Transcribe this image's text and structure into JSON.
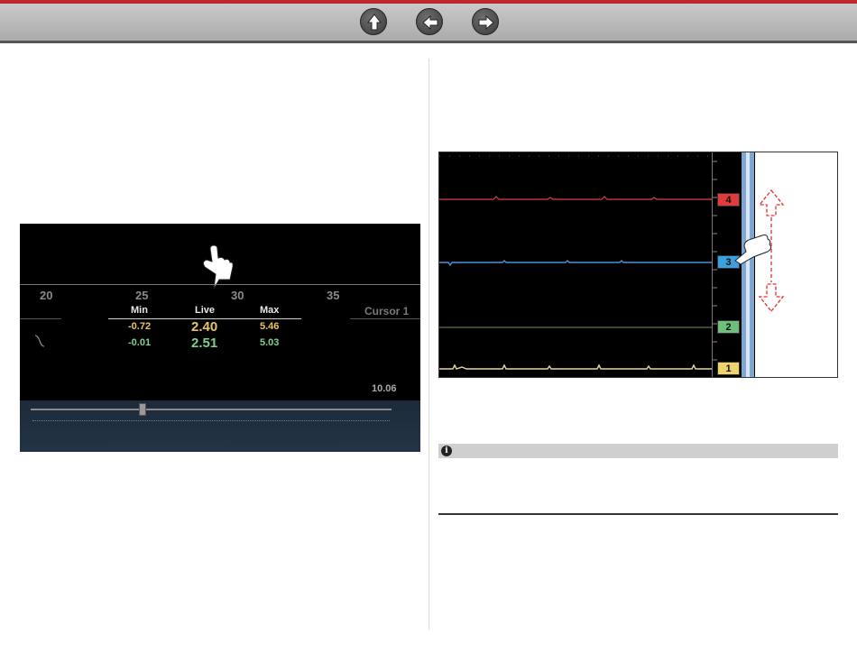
{
  "nav": {
    "home_icon": "home-up-arrow-icon",
    "back_icon": "left-arrow-icon",
    "forward_icon": "right-arrow-icon"
  },
  "left_screen": {
    "ticks": [
      "20",
      "25",
      "30",
      "35"
    ],
    "headers": {
      "min": "Min",
      "live": "Live",
      "max": "Max"
    },
    "row1": {
      "min": "-0.72",
      "live": "2.40",
      "max": "5.46"
    },
    "row2": {
      "min": "-0.01",
      "live": "2.51",
      "max": "5.03"
    },
    "cursor_label": "Cursor 1",
    "bottom_value": "10.06"
  },
  "right_screen": {
    "tags": [
      {
        "label": "4",
        "color": "#e03c3c"
      },
      {
        "label": "3",
        "color": "#3aa0e0"
      },
      {
        "label": "2",
        "color": "#6dbf7a"
      },
      {
        "label": "1",
        "color": "#f0d36e"
      }
    ],
    "trace_colors": [
      "#d94040",
      "#4a8fd8",
      "#6a8f5a",
      "#e8d49a"
    ]
  },
  "colors": {
    "accent_red": "#c0272d"
  }
}
